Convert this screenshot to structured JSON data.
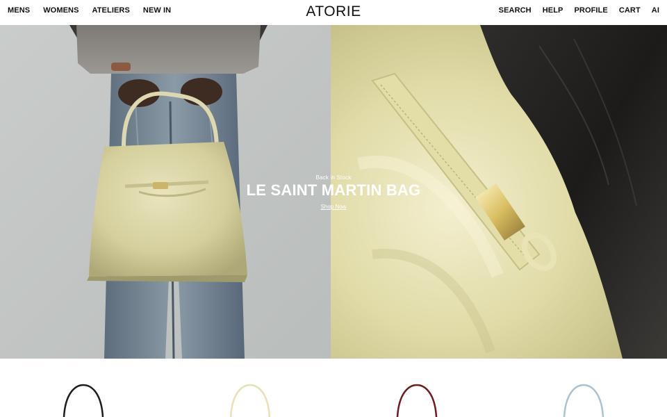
{
  "header": {
    "logo": "ATORIE",
    "nav_left": [
      "MENS",
      "WOMENS",
      "ATELIERS",
      "NEW IN"
    ],
    "nav_right": [
      "SEARCH",
      "HELP",
      "PROFILE",
      "CART",
      "AI"
    ]
  },
  "hero": {
    "kicker": "Back in Stock",
    "headline": "LE SAINT MARTIN BAG",
    "cta": "Shop Now"
  },
  "products": [
    {
      "name": "black-bag",
      "color": "#1d1d1d"
    },
    {
      "name": "butter-bag",
      "color": "#e6e2b4"
    },
    {
      "name": "burgundy-bag",
      "color": "#6d1a24"
    },
    {
      "name": "light-blue-bag",
      "color": "#a9c3d2"
    }
  ]
}
